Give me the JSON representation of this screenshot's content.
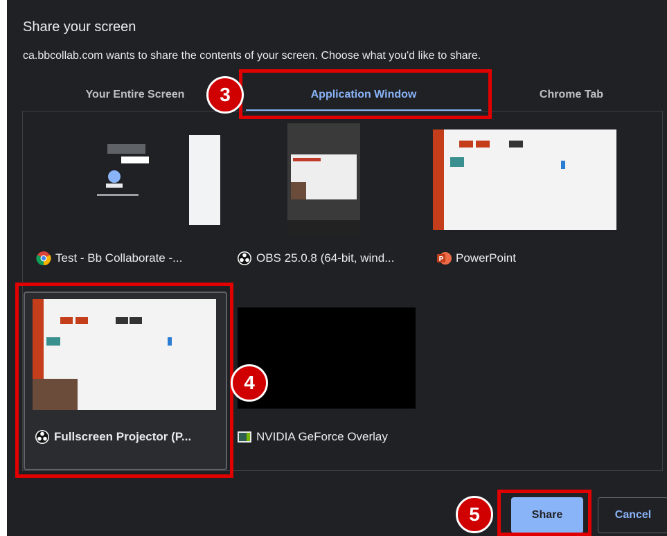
{
  "dialog": {
    "title": "Share your screen",
    "description": "ca.bbcollab.com wants to share the contents of your screen. Choose what you'd like to share."
  },
  "tabs": [
    {
      "label": "Your Entire Screen",
      "active": false
    },
    {
      "label": "Application Window",
      "active": true
    },
    {
      "label": "Chrome Tab",
      "active": false
    }
  ],
  "windows": [
    {
      "label": "Test - Bb Collaborate -...",
      "icon": "chrome-icon",
      "selected": false
    },
    {
      "label": "OBS 25.0.8 (64-bit, wind...",
      "icon": "obs-icon",
      "selected": false
    },
    {
      "label": "PowerPoint",
      "icon": "powerpoint-icon",
      "selected": false
    },
    {
      "label": "Fullscreen Projector (P...",
      "icon": "obs-icon",
      "selected": true
    },
    {
      "label": "NVIDIA GeForce Overlay",
      "icon": "nvidia-overlay-icon",
      "selected": false
    }
  ],
  "buttons": {
    "share": "Share",
    "cancel": "Cancel"
  },
  "annotations": {
    "step_tab": "3",
    "step_window": "4",
    "step_share": "5"
  },
  "colors": {
    "accent": "#8ab4f8",
    "background": "#202124",
    "callout": "#e00000"
  }
}
